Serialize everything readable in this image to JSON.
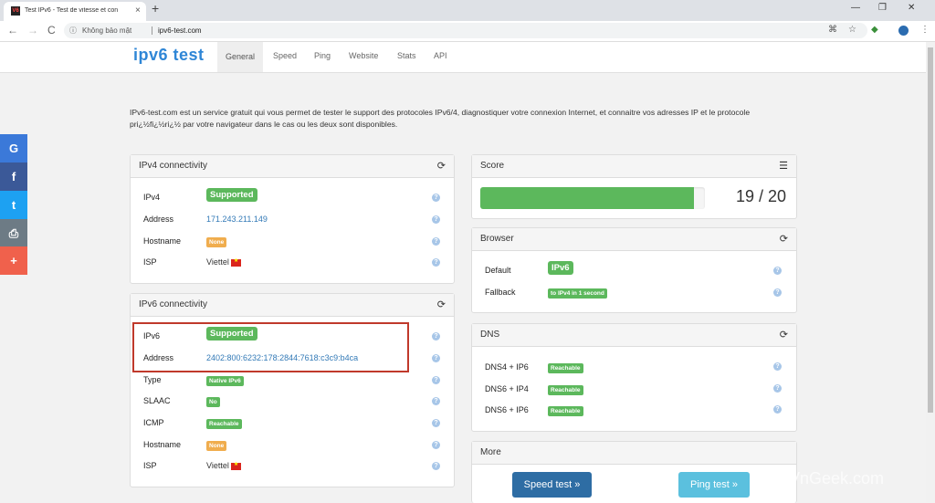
{
  "browser": {
    "tab_title": "Test IPv6 - Test de vitesse et con",
    "tab_close": "×",
    "new_tab": "+",
    "back": "←",
    "forward": "→",
    "reload": "C",
    "security_text": "Không bảo mật",
    "url": "ipv6-test.com"
  },
  "site": {
    "logo": "ipv6 test",
    "nav": [
      "General",
      "Speed",
      "Ping",
      "Website",
      "Stats",
      "API"
    ]
  },
  "intro": "IPv6-test.com est un service gratuit qui vous permet de tester le support des protocoles IPv6/4, diagnostiquer votre connexion Internet, et connaitre vos adresses IP et le protocole pri¿½fi¿½ri¿½ par votre navigateur dans le cas ou les deux sont disponibles.",
  "social": [
    {
      "name": "google",
      "glyph": "G",
      "color": "#3b79d9"
    },
    {
      "name": "facebook",
      "glyph": "f",
      "color": "#3b5998"
    },
    {
      "name": "twitter",
      "glyph": "t",
      "color": "#1da1f2"
    },
    {
      "name": "print",
      "glyph": "⎙",
      "color": "#6d7b85"
    },
    {
      "name": "more",
      "glyph": "+",
      "color": "#f0614c"
    }
  ],
  "ipv4": {
    "title": "IPv4 connectivity",
    "rows": [
      {
        "label": "IPv4",
        "value": "Supported"
      },
      {
        "label": "Address",
        "value": "171.243.211.149"
      },
      {
        "label": "Hostname",
        "value": "None"
      },
      {
        "label": "ISP",
        "value": "Viettel"
      }
    ]
  },
  "ipv6": {
    "title": "IPv6 connectivity",
    "rows": [
      {
        "label": "IPv6",
        "value": "Supported"
      },
      {
        "label": "Address",
        "value": "2402:800:6232:178:2844:7618:c3c9:b4ca"
      },
      {
        "label": "Type",
        "value": "Native IPv6"
      },
      {
        "label": "SLAAC",
        "value": "No"
      },
      {
        "label": "ICMP",
        "value": "Reachable"
      },
      {
        "label": "Hostname",
        "value": "None"
      },
      {
        "label": "ISP",
        "value": "Viettel"
      }
    ]
  },
  "score": {
    "title": "Score",
    "value": "19 / 20",
    "progress": 0.95
  },
  "browser_panel": {
    "title": "Browser",
    "rows": [
      {
        "label": "Default",
        "value": "IPv6"
      },
      {
        "label": "Fallback",
        "value": "to IPv4 in 1 second"
      }
    ]
  },
  "dns": {
    "title": "DNS",
    "rows": [
      {
        "label": "DNS4 + IP6",
        "value": "Reachable"
      },
      {
        "label": "DNS6 + IP4",
        "value": "Reachable"
      },
      {
        "label": "DNS6 + IP6",
        "value": "Reachable"
      }
    ]
  },
  "more": {
    "title": "More",
    "speed_button": "Speed test »",
    "ping_button": "Ping test »"
  },
  "watermark": "VnGeek.com",
  "icons": {
    "refresh": "⟳",
    "list": "☰",
    "help": "?"
  },
  "colors": {
    "success": "#5cb85c",
    "warning": "#f0ad4e",
    "link": "#337ab7",
    "highlight": "#c0392b"
  }
}
